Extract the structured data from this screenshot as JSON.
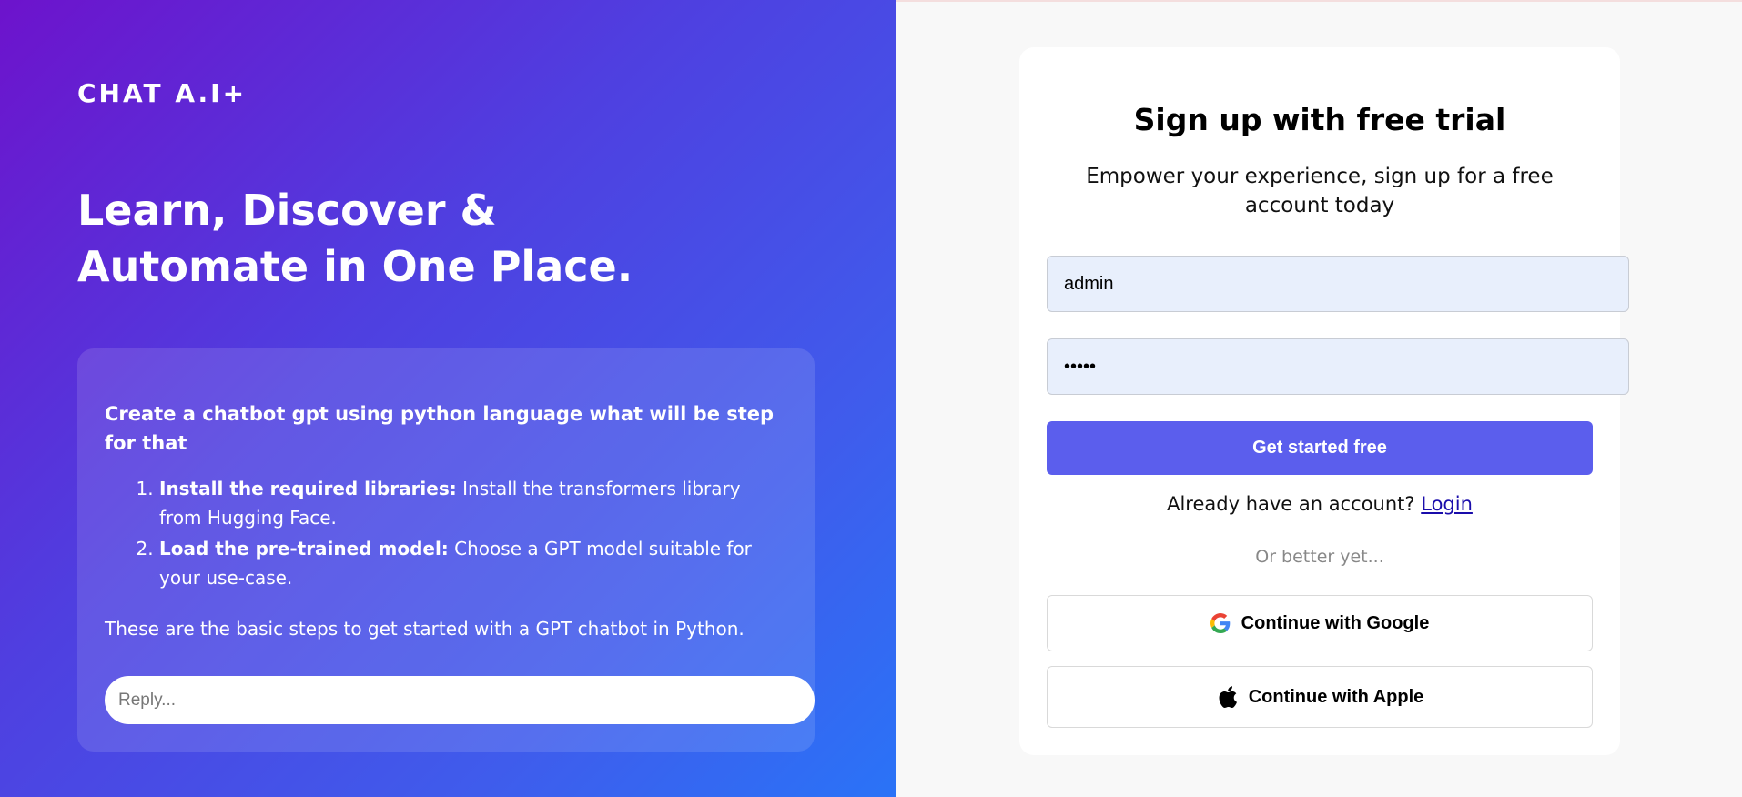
{
  "brand": {
    "name": "CHAT A.I+"
  },
  "hero": {
    "headline_line1": "Learn, Discover &",
    "headline_line2": "Automate in One Place."
  },
  "chat": {
    "question": "Create a chatbot gpt using python language what will be step for that",
    "steps": [
      {
        "title": "Install the required libraries:",
        "text": " Install the transformers library from Hugging Face."
      },
      {
        "title": "Load the pre-trained model:",
        "text": " Choose a GPT model suitable for your use-case."
      }
    ],
    "footer": "These are the basic steps to get started with a GPT chatbot in Python.",
    "reply_placeholder": "Reply..."
  },
  "signup": {
    "title": "Sign up with free trial",
    "subtitle": "Empower your experience, sign up for a free account today",
    "username_value": "admin",
    "password_value": "admin",
    "submit_label": "Get started free",
    "login_prompt": "Already have an account?",
    "login_link": "Login",
    "divider": "Or better yet...",
    "google_label": "Continue with Google",
    "apple_label": "Continue with Apple"
  },
  "icons": {
    "google": "google-icon",
    "apple": "apple-icon"
  },
  "colors": {
    "gradient_start": "#6d13cc",
    "gradient_end": "#2a73f7",
    "primary_button": "#5b5eed",
    "input_background": "#e8effc",
    "link": "#1a0dab"
  }
}
